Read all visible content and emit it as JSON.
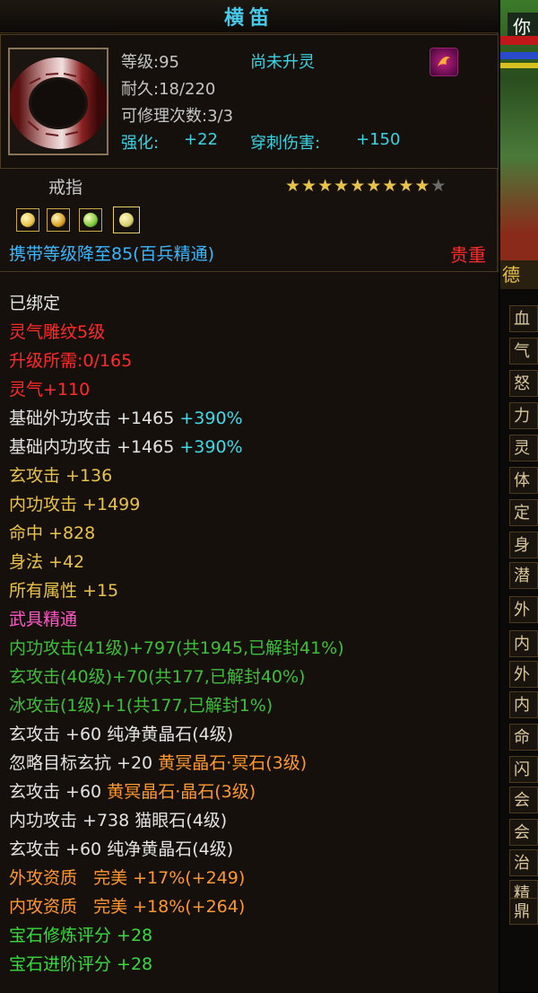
{
  "tooltip": {
    "title": "横笛",
    "level": "等级:95",
    "spirit_status": "尚未升灵",
    "durability": "耐久:18/220",
    "repairs": "可修理次数:3/3",
    "enhance_label": "强化:",
    "enhance_value": "+22",
    "pierce_label": "穿刺伤害:",
    "pierce_value": "+150",
    "item_type": "戒指",
    "stars_filled": 9,
    "stars_total": 10,
    "gems": [
      "#e8c24a",
      "#d8a020",
      "#7acb3a",
      "#d9d070"
    ],
    "carry_note": "携带等级降至85(百兵精通)",
    "rarity": "贵重",
    "bound": "已绑定",
    "engrave": "灵气雕纹5级",
    "upgrade_need": "升级所需:0/165",
    "spirit": "灵气+110",
    "base_ext_attack": "基础外功攻击 +1465",
    "base_ext_attack_pct": "+390%",
    "base_int_attack": "基础内功攻击 +1465",
    "base_int_attack_pct": "+390%",
    "xuan_attack": "玄攻击 +136",
    "int_attack": "内功攻击 +1499",
    "hit": "命中 +828",
    "agility": "身法 +42",
    "all_attr": "所有属性 +15",
    "weapon_mastery": "武具精通",
    "mastery_1": "内功攻击(41级)+797(共1945,已解封41%)",
    "mastery_2": "玄攻击(40级)+70(共177,已解封40%)",
    "mastery_3": "冰攻击(1级)+1(共177,已解封1%)",
    "gem_1_stat": "玄攻击 +60",
    "gem_1_name": "纯净黄晶石(4级)",
    "gem_2_stat": "忽略目标玄抗 +20",
    "gem_2_name": "黄冥晶石·冥石(3级)",
    "gem_3_stat": "玄攻击 +60",
    "gem_3_name": "黄冥晶石·晶石(3级)",
    "gem_4_stat": "内功攻击 +738",
    "gem_4_name": "猫眼石(4级)",
    "gem_5_stat": "玄攻击 +60",
    "gem_5_name": "纯净黄晶石(4级)",
    "ext_quality_label": "外攻资质",
    "ext_quality_value": "完美 +17%(+249)",
    "int_quality_label": "内攻资质",
    "int_quality_value": "完美 +18%(+264)",
    "gem_refine_score": "宝石修炼评分 +28",
    "gem_advance_score": "宝石进阶评分 +28"
  },
  "side_panel": {
    "top_text": "你",
    "tab_header": "德",
    "tabs": [
      "血",
      "气",
      "怒",
      "力",
      "灵",
      "体",
      "定",
      "身",
      "潜",
      "外",
      "内",
      "外",
      "内",
      "命",
      "闪",
      "会",
      "会",
      "治",
      "精",
      "鼎"
    ]
  }
}
